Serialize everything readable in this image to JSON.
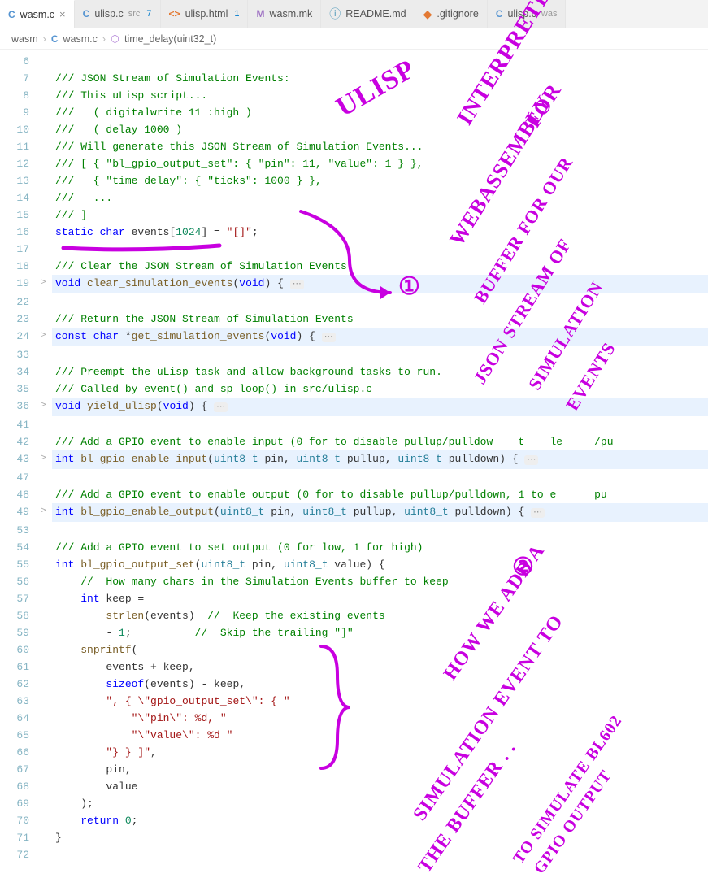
{
  "tabs": [
    {
      "icon": "C",
      "iconClass": "lang-c",
      "label": "wasm.c",
      "active": true,
      "close": "×"
    },
    {
      "icon": "C",
      "iconClass": "lang-c",
      "label": "ulisp.c",
      "sub": "src",
      "badge": "7"
    },
    {
      "icon": "<>",
      "iconClass": "lang-html",
      "label": "ulisp.html",
      "badge": "1"
    },
    {
      "icon": "M",
      "iconClass": "lang-mk",
      "label": "wasm.mk"
    },
    {
      "icon": "ⓘ",
      "iconClass": "lang-md",
      "label": "README.md"
    },
    {
      "icon": "◆",
      "iconClass": "lang-git",
      "label": ".gitignore"
    },
    {
      "icon": "C",
      "iconClass": "lang-c",
      "label": "ulisp.c",
      "sub": "was"
    }
  ],
  "breadcrumbs": {
    "seg1": "wasm",
    "seg2": "wasm.c",
    "seg3": "time_delay(uint32_t)"
  },
  "code": {
    "l6": "",
    "l7": "/// JSON Stream of Simulation Events:",
    "l8": "/// This uLisp script...",
    "l9": "///   ( digitalwrite 11 :high )",
    "l10": "///   ( delay 1000 )",
    "l11": "/// Will generate this JSON Stream of Simulation Events...",
    "l12": "/// [ { \"bl_gpio_output_set\": { \"pin\": 11, \"value\": 1 } },",
    "l13": "///   { \"time_delay\": { \"ticks\": 1000 } },",
    "l14": "///   ...",
    "l15": "/// ]",
    "l16_pre": "static char ",
    "l16_id": "events",
    "l16_br1": "[",
    "l16_num": "1024",
    "l16_br2": "] = ",
    "l16_str": "\"[]\"",
    "l16_end": ";",
    "l17": "",
    "l18": "/// Clear the JSON Stream of Simulation Events",
    "l19_kw": "void ",
    "l19_fn": "clear_simulation_events",
    "l19_rest": "(",
    "l19_void": "void",
    "l19_tail": ") {",
    "l22": "",
    "l23": "/// Return the JSON Stream of Simulation Events",
    "l24_kw": "const char ",
    "l24_star": "*",
    "l24_fn": "get_simulation_events",
    "l24_rest": "(",
    "l24_void": "void",
    "l24_tail": ") {",
    "l33": "",
    "l34": "/// Preempt the uLisp task and allow background tasks to run.",
    "l35": "/// Called by event() and sp_loop() in src/ulisp.c",
    "l36_kw": "void ",
    "l36_fn": "yield_ulisp",
    "l36_rest": "(",
    "l36_void": "void",
    "l36_tail": ") {",
    "l41": "",
    "l42": "/// Add a GPIO event to enable input (0 for to disable pullup/pulldow    t    le     /pu",
    "l43_kw": "int ",
    "l43_fn": "bl_gpio_enable_input",
    "l43_rest": "(",
    "l43_t1": "uint8_t",
    "l43_p1": " pin, ",
    "l43_t2": "uint8_t",
    "l43_p2": " pullup, ",
    "l43_t3": "uint8_t",
    "l43_p3": " pulldown) { ",
    "l47": "",
    "l48": "/// Add a GPIO event to enable output (0 for to disable pullup/pulldown, 1 to e      pu",
    "l49_kw": "int ",
    "l49_fn": "bl_gpio_enable_output",
    "l49_rest": "(",
    "l49_t1": "uint8_t",
    "l49_p1": " pin, ",
    "l49_t2": "uint8_t",
    "l49_p2": " pullup, ",
    "l49_t3": "uint8_t",
    "l49_p3": " pulldown) { ",
    "l53": "",
    "l54": "/// Add a GPIO event to set output (0 for low, 1 for high)",
    "l55_kw": "int ",
    "l55_fn": "bl_gpio_output_set",
    "l55_rest": "(",
    "l55_t1": "uint8_t",
    "l55_p1": " pin, ",
    "l55_t2": "uint8_t",
    "l55_p2": " value) {",
    "l56": "    //  How many chars in the Simulation Events buffer to keep",
    "l57_a": "    ",
    "l57_kw": "int",
    "l57_b": " keep =",
    "l58_a": "        ",
    "l58_fn": "strlen",
    "l58_b": "(events)  ",
    "l58_c": "//  Keep the existing events",
    "l59_a": "        - ",
    "l59_n": "1",
    "l59_b": ";          ",
    "l59_c": "//  Skip the trailing \"]\"",
    "l60_a": "    ",
    "l60_fn": "snprintf",
    "l60_b": "(",
    "l61": "        events + keep,",
    "l62_a": "        ",
    "l62_fn": "sizeof",
    "l62_b": "(events) - keep,",
    "l63_a": "        ",
    "l63_s": "\", { \\\"gpio_output_set\\\": { \"",
    "l64_a": "            ",
    "l64_s": "\"\\\"pin\\\": %d, \"",
    "l65_a": "            ",
    "l65_s": "\"\\\"value\\\": %d \"",
    "l66_a": "        ",
    "l66_s": "\"} } ]\"",
    "l66_b": ",",
    "l67": "        pin,",
    "l68": "        value",
    "l69": "    );",
    "l70_a": "    ",
    "l70_kw": "return",
    "l70_b": " ",
    "l70_n": "0",
    "l70_c": ";",
    "l71": "}",
    "l72": ""
  },
  "linenums": [
    "6",
    "7",
    "8",
    "9",
    "10",
    "11",
    "12",
    "13",
    "14",
    "15",
    "16",
    "17",
    "18",
    "19",
    "22",
    "23",
    "24",
    "33",
    "34",
    "35",
    "36",
    "41",
    "42",
    "43",
    "47",
    "48",
    "49",
    "53",
    "54",
    "55",
    "56",
    "57",
    "58",
    "59",
    "60",
    "61",
    "62",
    "63",
    "64",
    "65",
    "66",
    "67",
    "68",
    "69",
    "70",
    "71",
    "72"
  ],
  "folds": {
    "19": ">",
    "24": ">",
    "36": ">",
    "43": ">",
    "49": ">"
  },
  "highlights": [
    "19",
    "24",
    "36",
    "43",
    "49"
  ],
  "annotations": {
    "a1": "ULISP",
    "a2": "INTERPRETER",
    "a3": "FOR",
    "a4": "WEBASSEMBLY",
    "a5": "①",
    "a6": "BUFFER FOR OUR",
    "a7": "JSON STREAM OF",
    "a8": "SIMULATION",
    "a9": "EVENTS",
    "b1": "②",
    "b2": "HOW WE ADD A",
    "b3": "SIMULATION EVENT TO",
    "b4": "THE BUFFER . .",
    "b5": "TO SIMULATE BL602",
    "b6": "GPIO OUTPUT"
  }
}
